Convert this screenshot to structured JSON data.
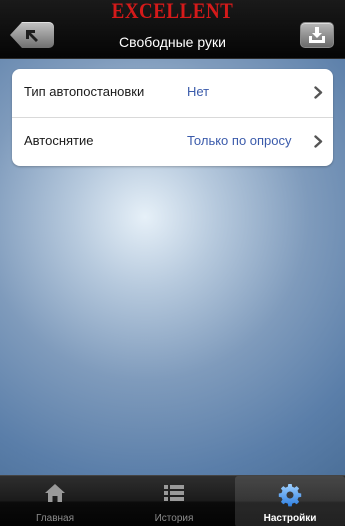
{
  "header": {
    "brand": "EXCELLENT",
    "title": "Свободные руки",
    "back_icon": "back-arrow-icon",
    "download_icon": "download-icon"
  },
  "settings": {
    "items": [
      {
        "label": "Тип автопостановки",
        "value": "Нет"
      },
      {
        "label": "Автоснятие",
        "value": "Только по опросу"
      }
    ]
  },
  "tabbar": {
    "tabs": [
      {
        "label": "Главная",
        "icon": "home-icon",
        "active": false
      },
      {
        "label": "История",
        "icon": "list-icon",
        "active": false
      },
      {
        "label": "Настройки",
        "icon": "gear-icon",
        "active": true
      }
    ]
  },
  "colors": {
    "brand": "#d41a1a",
    "value_text": "#3b5bab",
    "active_tab_label": "#ffffff",
    "inactive_tab_label": "#8b8b8b"
  }
}
